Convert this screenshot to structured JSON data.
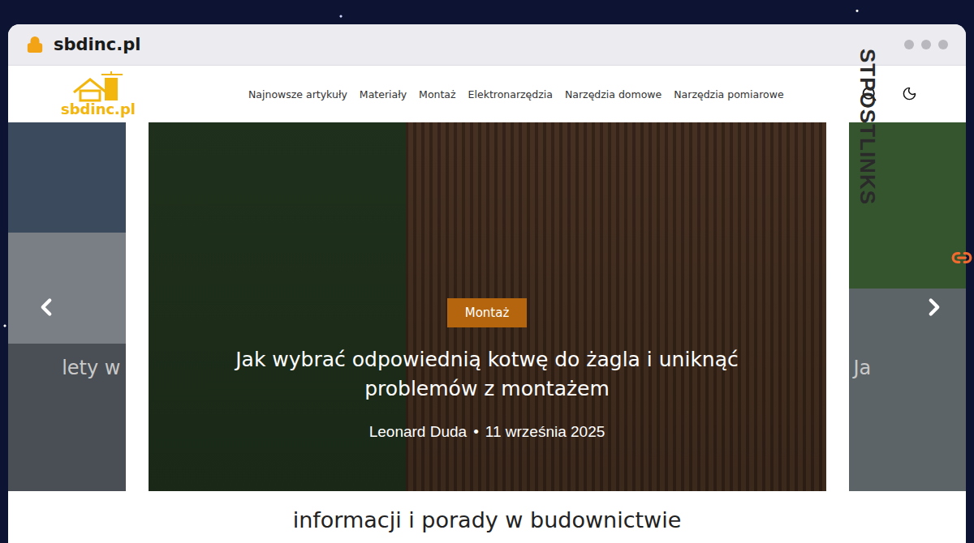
{
  "browser": {
    "url": "sbdinc.pl"
  },
  "header": {
    "logo_text": "sbdinc.pl",
    "nav": [
      "Najnowsze artykuły",
      "Materiały",
      "Montaż",
      "Elektronarzędzia",
      "Narzędzia domowe",
      "Narzędzia pomiarowe"
    ]
  },
  "carousel": {
    "slides": [
      {
        "kind": "left",
        "title": "lety w"
      },
      {
        "kind": "center",
        "category": "Montaż",
        "title": "Jak wybrać odpowiednią kotwę do żagla i uniknąć problemów z montażem",
        "author": "Leonard Duda",
        "separator": "•",
        "date": "11 września 2025"
      },
      {
        "kind": "right",
        "title": "Ja"
      }
    ]
  },
  "section_heading": "informacji i porady w budownictwie",
  "watermark": "STPOSTLINKS"
}
